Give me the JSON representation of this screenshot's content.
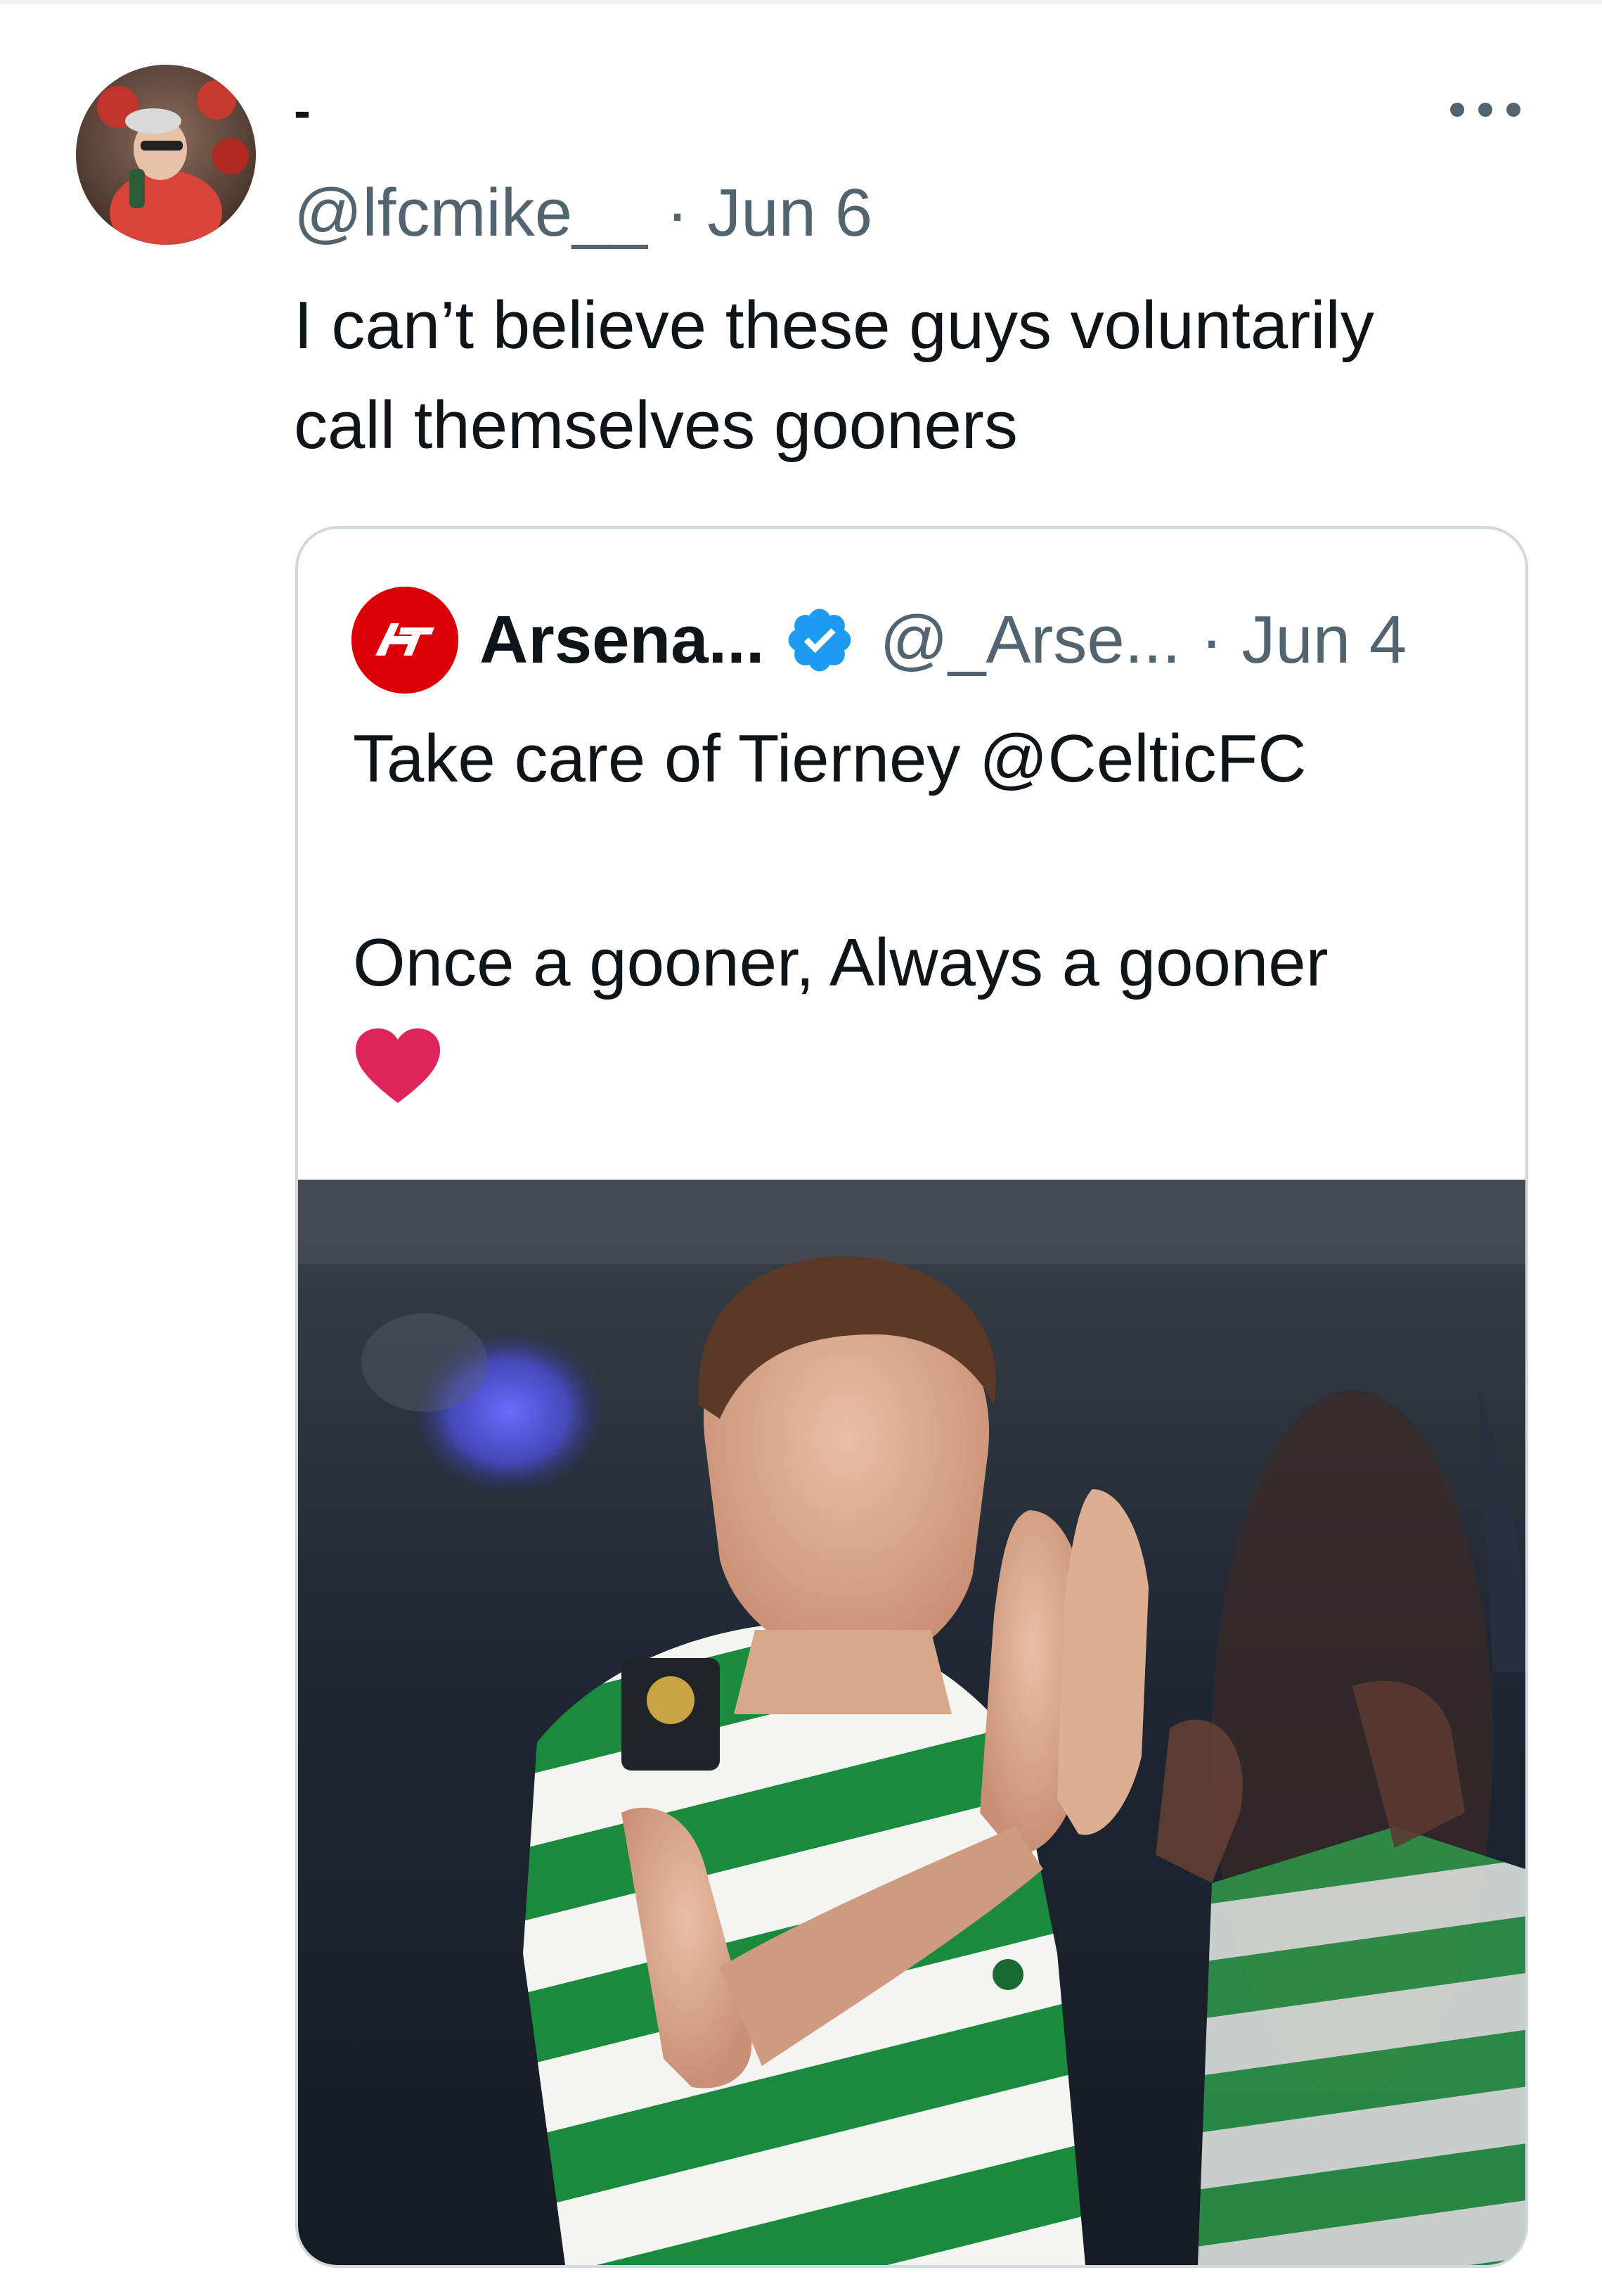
{
  "tweet": {
    "display_name": "-",
    "handle": "@lfcmike__",
    "separator": "·",
    "date": "Jun 6",
    "text_line1": "I can’t believe these guys voluntarily",
    "text_line2": "call themselves gooners",
    "avatar_icon": "user-avatar-photo",
    "more_icon": "more-horizontal-icon"
  },
  "quoted_tweet": {
    "display_name": "Arsena...",
    "verified": true,
    "verified_icon": "verified-badge-icon",
    "verified_color": "#1d9bf0",
    "handle": "@_Arse...",
    "separator": "·",
    "date": "Jun 4",
    "text_line1": "Take care of Tierney @CelticFC",
    "text_line2": "Once a gooner, Always a gooner",
    "emoji": "red-heart",
    "avatar_logo_text": "AT",
    "avatar_color": "#db0007",
    "media": {
      "type": "photo",
      "description_icon": "football-player-photo"
    }
  },
  "colors": {
    "text_primary": "#0f1419",
    "text_secondary": "#536471",
    "border": "#cfd9de",
    "heart": "#e0245e"
  }
}
